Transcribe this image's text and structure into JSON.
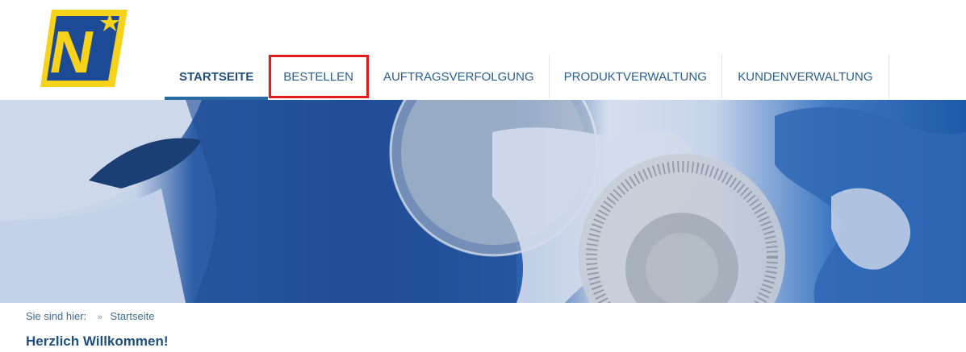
{
  "nav": {
    "items": [
      {
        "label": "STARTSEITE"
      },
      {
        "label": "BESTELLEN"
      },
      {
        "label": "AUFTRAGSVERFOLGUNG"
      },
      {
        "label": "PRODUKTVERWALTUNG"
      },
      {
        "label": "KUNDENVERWALTUNG"
      }
    ],
    "active_index": 0,
    "highlighted_index": 1
  },
  "logo": {
    "icon": "noe-logo-icon",
    "letter": "N"
  },
  "banner": {
    "icon": "world-map-compass-banner"
  },
  "breadcrumb": {
    "prefix": "Sie sind hier:",
    "separator": "»",
    "current": "Startseite"
  },
  "main": {
    "heading": "Herzlich Willkommen!"
  },
  "colors": {
    "accent": "#2a6aa3",
    "nav_text": "#2a5e8c",
    "highlight_border": "#e31b1b",
    "logo_blue": "#1c4a96",
    "logo_yellow": "#f6d31a"
  }
}
